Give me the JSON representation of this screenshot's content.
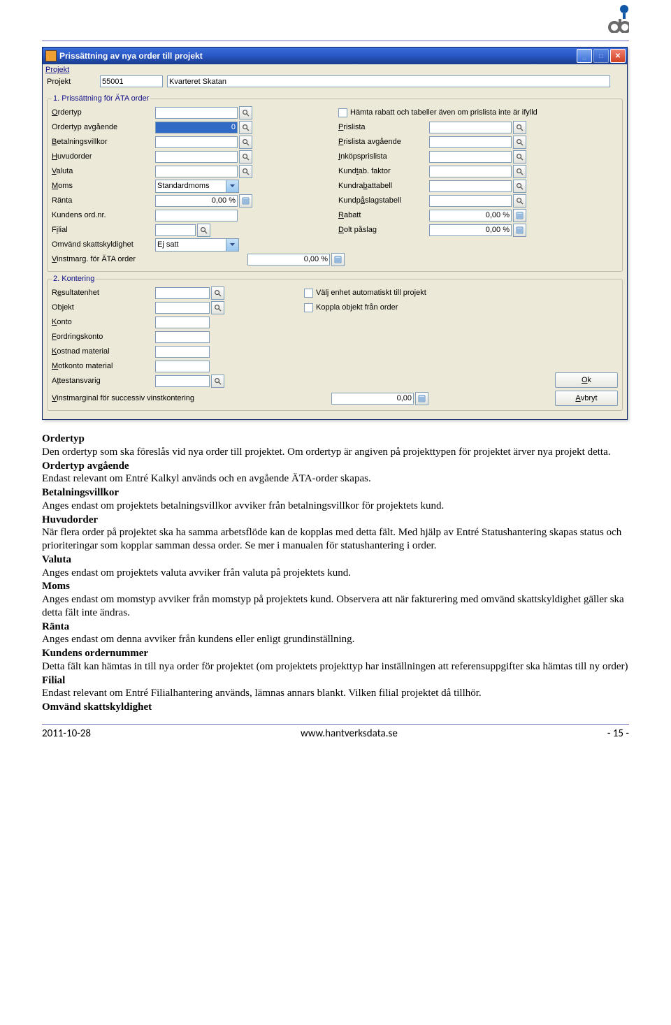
{
  "window": {
    "title": "Prissättning av nya order till projekt",
    "menu": {
      "projekt": "Projekt"
    },
    "project": {
      "label": "Projekt",
      "id": "55001",
      "name": "Kvarteret Skatan"
    },
    "group1": {
      "legend_prefix": "1",
      "legend": ". Prissättning för ÄTA order",
      "left": {
        "ordertyp": "Ordertyp",
        "ordertyp_avg": "Ordertyp avgående",
        "ordertyp_avg_val": "0",
        "betalningsvillkor": "Betalningsvillkor",
        "huvudorder": "Huvudorder",
        "valuta": "Valuta",
        "moms": "Moms",
        "moms_val": "Standardmoms",
        "ranta": "Ränta",
        "ranta_val": "0,00 %",
        "kundens_ord": "Kundens ord.nr.",
        "filial": "Filial",
        "omvand": "Omvänd skattskyldighet",
        "omvand_val": "Ej satt",
        "vinstmarg": "Vinstmarg. för ÄTA order",
        "vinstmarg_val": "0,00 %"
      },
      "right": {
        "chk_hamta": "Hämta rabatt och tabeller även om prislista inte är ifylld",
        "prislista": "Prislista",
        "prislista_avg": "Prislista avgående",
        "inkopsprislista": "Inköpsprislista",
        "kundtab": "Kundtab. faktor",
        "kundrabattabell": "Kundrabattabell",
        "kundpaslagstabell": "Kundpåslagstabell",
        "rabatt": "Rabatt",
        "rabatt_val": "0,00 %",
        "dolt_paslag": "Dolt påslag",
        "dolt_paslag_val": "0,00 %"
      }
    },
    "group2": {
      "legend_prefix": "2",
      "legend": ". Kontering",
      "left": {
        "resultatenhet": "Resultatenhet",
        "objekt": "Objekt",
        "konto": "Konto",
        "fordringskonto": "Fordringskonto",
        "kostnad_material": "Kostnad material",
        "motkonto_material": "Motkonto material",
        "attestansvarig": "Attestansvarig",
        "vinstmarginal": "Vinstmarginal för successiv vinstkontering",
        "vinstmarginal_val": "0,00"
      },
      "right": {
        "chk_valj": "Välj enhet automatiskt till projekt",
        "chk_koppla": "Koppla objekt från order"
      },
      "buttons": {
        "ok": "Ok",
        "avbryt": "Avbryt"
      }
    }
  },
  "doc": {
    "h_ordertyp": "Ordertyp",
    "p_ordertyp": "Den ordertyp som ska föreslås vid nya order till projektet. Om ordertyp är angiven på projekttypen för projektet ärver nya projekt detta.",
    "h_ordertyp_avg": "Ordertyp avgående",
    "p_ordertyp_avg": "Endast relevant om Entré Kalkyl används och en avgående ÄTA-order skapas.",
    "h_betalningsvillkor": "Betalningsvillkor",
    "p_betalningsvillkor": "Anges endast om projektets betalningsvillkor avviker från betalningsvillkor för projektets kund.",
    "h_huvudorder": "Huvudorder",
    "p_huvudorder": "När flera order på projektet ska ha samma arbetsflöde kan de kopplas med detta fält. Med hjälp av Entré Statushantering skapas status och prioriteringar som kopplar samman dessa order. Se mer i manualen för statushantering i order.",
    "h_valuta": "Valuta",
    "p_valuta": "Anges endast om projektets valuta avviker från valuta på projektets kund.",
    "h_moms": "Moms",
    "p_moms": "Anges endast om momstyp avviker från momstyp på projektets kund. Observera att när fakturering med omvänd skattskyldighet gäller ska detta fält inte ändras.",
    "h_ranta": "Ränta",
    "p_ranta": "Anges endast om denna avviker från kundens eller enligt grundinställning.",
    "h_kundens": "Kundens ordernummer",
    "p_kundens": "Detta fält kan hämtas in till nya order för projektet (om projektets projekttyp har inställningen att referensuppgifter ska hämtas till ny order)",
    "h_filial": "Filial",
    "p_filial": "Endast relevant om Entré Filialhantering används, lämnas annars blankt. Vilken filial projektet då tillhör.",
    "h_omvand": "Omvänd skattskyldighet"
  },
  "footer": {
    "date": "2011-10-28",
    "url": "www.hantverksdata.se",
    "page": "- 15 -"
  }
}
